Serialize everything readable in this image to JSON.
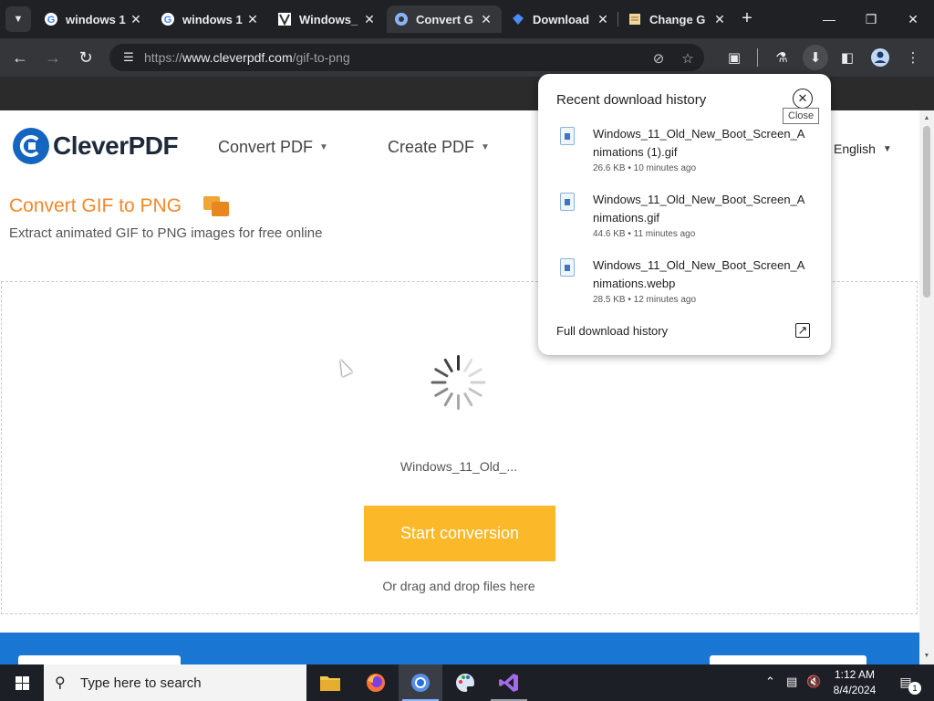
{
  "browser": {
    "tabs": [
      {
        "title": "windows 1",
        "favicon": "google-icon"
      },
      {
        "title": "windows 1",
        "favicon": "google-icon"
      },
      {
        "title": "Windows_",
        "favicon": "document-icon"
      },
      {
        "title": "Convert G",
        "favicon": "cleverpdf-icon",
        "active": true
      },
      {
        "title": "Download",
        "favicon": "diamond-icon"
      },
      {
        "title": "Change G",
        "favicon": "notes-icon"
      }
    ],
    "url_prefix": "https://",
    "url_host": "www.cleverpdf.com",
    "url_path": "/gif-to-png"
  },
  "site": {
    "logo_text": "CleverPDF",
    "nav": [
      {
        "label": "Convert PDF"
      },
      {
        "label": "Create PDF"
      }
    ],
    "language": "English"
  },
  "tool": {
    "title": "Convert GIF to PNG",
    "subtitle": "Extract animated GIF to PNG images for free online",
    "file_name": "Windows_11_Old_...",
    "start_button": "Start conversion",
    "drag_hint": "Or drag and drop files here"
  },
  "downloads": {
    "title": "Recent download history",
    "close_tooltip": "Close",
    "items": [
      {
        "name": "Windows_11_Old_New_Boot_Screen_Animations (1).gif",
        "meta": "26.6 KB • 10 minutes ago"
      },
      {
        "name": "Windows_11_Old_New_Boot_Screen_Animations.gif",
        "meta": "44.6 KB • 11 minutes ago"
      },
      {
        "name": "Windows_11_Old_New_Boot_Screen_Animations.webp",
        "meta": "28.5 KB • 12 minutes ago"
      }
    ],
    "full_history": "Full download history"
  },
  "taskbar": {
    "search_placeholder": "Type here to search",
    "time": "1:12 AM",
    "date": "8/4/2024",
    "notification_count": "1"
  },
  "colors": {
    "accent_orange": "#f5872a",
    "button_yellow": "#fbb829",
    "brand_blue": "#1565c0"
  }
}
